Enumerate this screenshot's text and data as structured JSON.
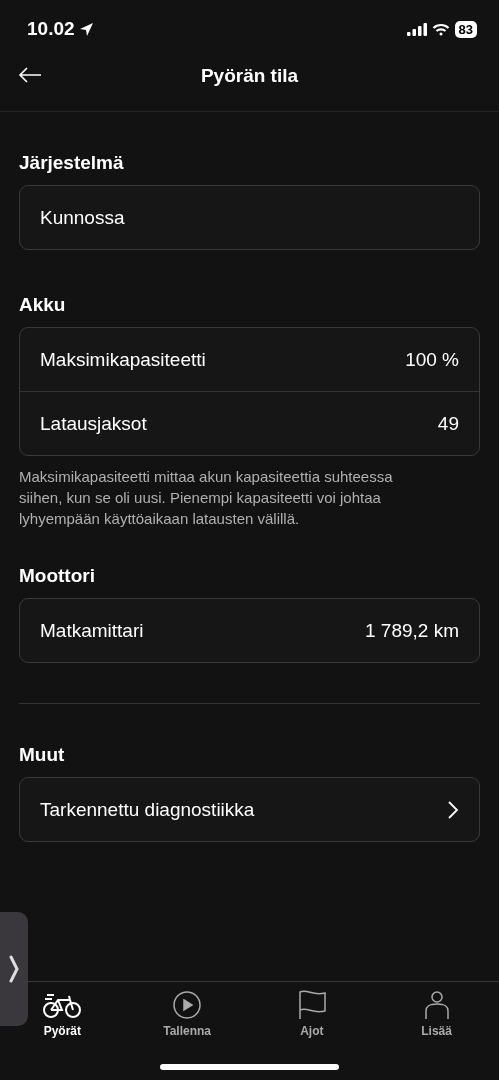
{
  "status_bar": {
    "time": "10.02",
    "battery": "83"
  },
  "header": {
    "title": "Pyörän tila"
  },
  "sections": [
    {
      "title": "Järjestelmä",
      "divider_before": false,
      "rows": [
        {
          "kind": "value",
          "label": "Kunnossa"
        }
      ]
    },
    {
      "title": "Akku",
      "divider_before": false,
      "rows": [
        {
          "kind": "value",
          "label": "Maksimikapasiteetti",
          "value": "100 %"
        },
        {
          "kind": "value",
          "label": "Latausjaksot",
          "value": "49"
        }
      ],
      "note": "Maksimikapasiteetti mittaa akun kapasiteettia suhteessa siihen, kun se oli uusi. Pienempi kapasiteetti voi johtaa lyhyempään käyttöaikaan latausten välillä."
    },
    {
      "title": "Moottori",
      "divider_before": false,
      "rows": [
        {
          "kind": "value",
          "label": "Matkamittari",
          "value": "1 789,2 km"
        }
      ]
    },
    {
      "title": "Muut",
      "divider_before": true,
      "rows": [
        {
          "kind": "link",
          "label": "Tarkennettu diagnostiikka"
        }
      ]
    }
  ],
  "tabs": [
    {
      "kind": "bike",
      "label": "Pyörät",
      "selected": true
    },
    {
      "kind": "record",
      "label": "Tallenna",
      "selected": false
    },
    {
      "kind": "flag",
      "label": "Ajot",
      "selected": false
    },
    {
      "kind": "person",
      "label": "Lisää",
      "selected": false
    }
  ]
}
